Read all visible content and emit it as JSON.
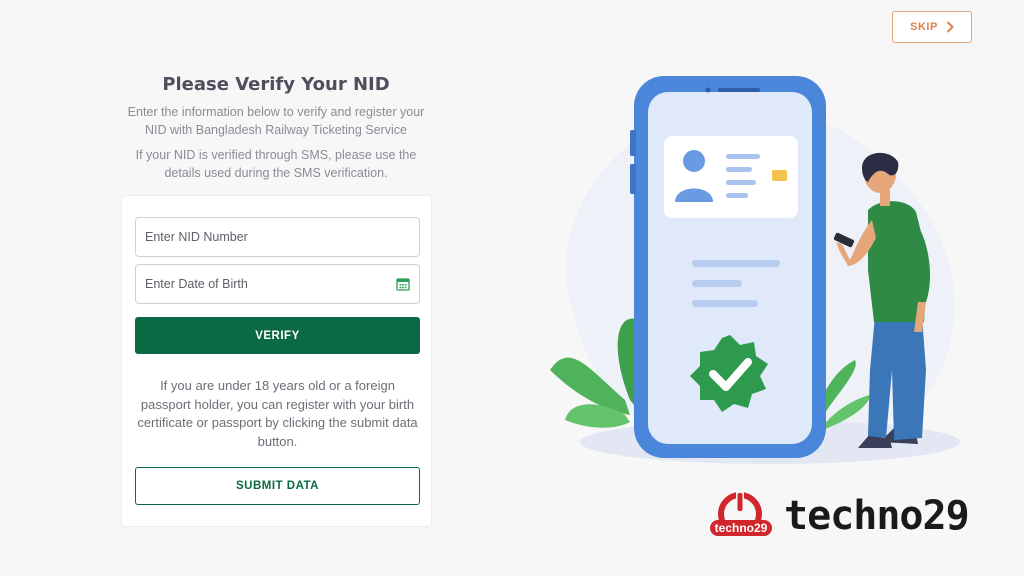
{
  "header": {
    "skip_label": "SKIP"
  },
  "form": {
    "title": "Please Verify Your NID",
    "intro": "Enter the information below to verify and register your NID with Bangladesh Railway Ticketing Service",
    "sms_note": "If your NID is verified through SMS, please use the details used during the SMS verification.",
    "nid_placeholder": "Enter NID Number",
    "dob_placeholder": "Enter Date of Birth",
    "verify_label": "VERIFY",
    "alt_note": "If you are under 18 years old or a foreign passport holder, you can register with your birth certificate or passport by clicking the submit data button.",
    "submit_label": "SUBMIT DATA"
  },
  "watermark": {
    "text": "techno29",
    "logo_text": "techno29"
  },
  "colors": {
    "primary_green": "#0b6a43",
    "skip_accent": "#d9824c",
    "phone_blue": "#4a86d9"
  },
  "icons": [
    "chevron-right-icon",
    "calendar-icon",
    "check-badge-icon",
    "id-card-icon",
    "power-icon"
  ]
}
